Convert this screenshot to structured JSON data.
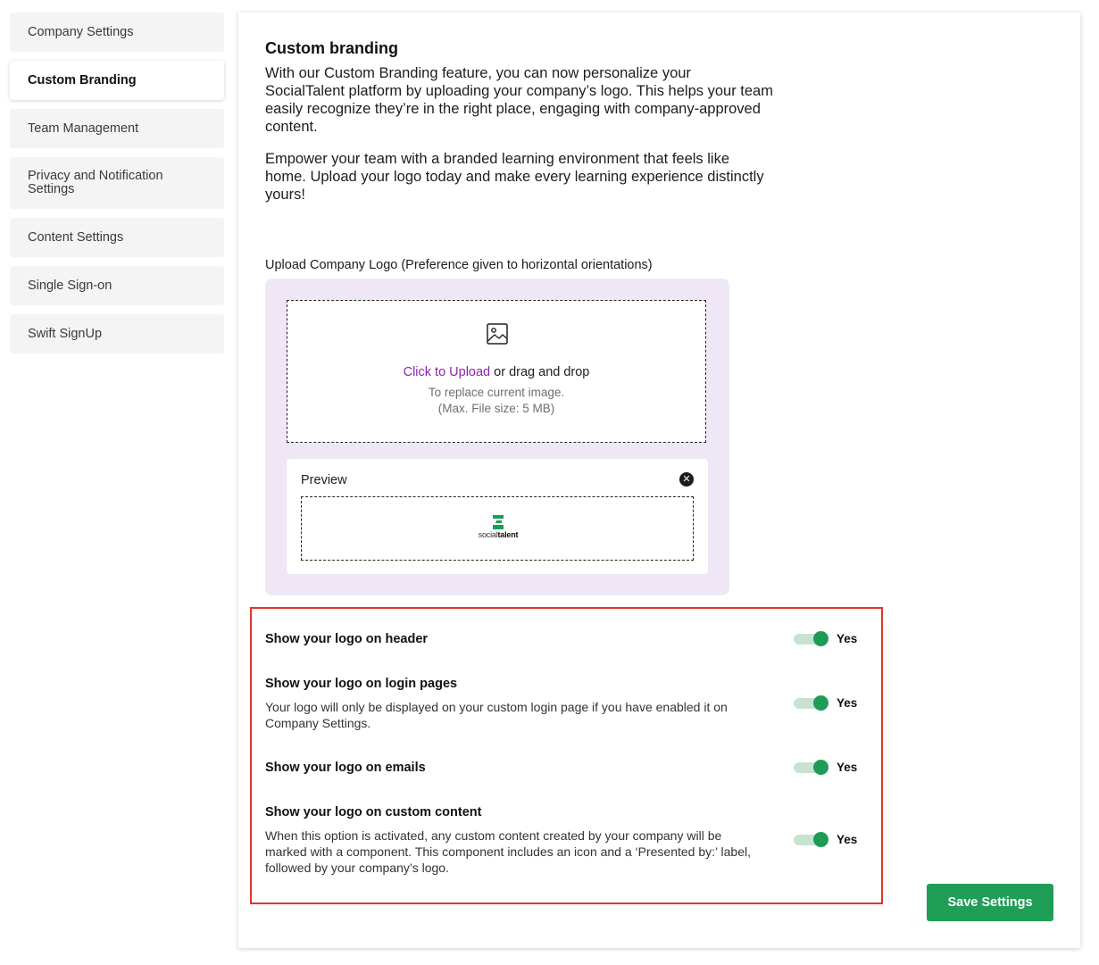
{
  "sidebar": {
    "items": [
      {
        "label": "Company Settings"
      },
      {
        "label": "Custom Branding"
      },
      {
        "label": "Team Management"
      },
      {
        "label": "Privacy and Notification Settings"
      },
      {
        "label": "Content Settings"
      },
      {
        "label": "Single Sign-on"
      },
      {
        "label": "Swift SignUp"
      }
    ],
    "active": "Custom Branding"
  },
  "main": {
    "title": "Custom branding",
    "paragraph1": "With our Custom Branding feature, you can now personalize your SocialTalent platform by uploading your company’s logo. This helps your team easily recognize they’re in the right place, engaging with company-approved content.",
    "paragraph2": "Empower your team with a branded learning environment that feels like home. Upload your logo today and make every learning experience distinctly yours!",
    "upload": {
      "label": "Upload Company Logo (Preference given to horizontal orientations)",
      "click_text": "Click to Upload",
      "drag_text": "or drag and drop",
      "sub1": "To replace current image.",
      "sub2": "(Max. File size: 5 MB)",
      "preview_label": "Preview",
      "preview_logo_text_light": "social",
      "preview_logo_text_bold": "talent"
    },
    "settings": [
      {
        "title": "Show your logo on header",
        "description": "",
        "toggle": "Yes"
      },
      {
        "title": "Show your logo on login pages",
        "description": "Your logo will only be displayed on your custom login page if you have enabled it on Company Settings.",
        "toggle": "Yes"
      },
      {
        "title": "Show your logo on emails",
        "description": "",
        "toggle": "Yes"
      },
      {
        "title": "Show your logo on custom content",
        "description": "When this option is activated, any custom content created by your company will be marked with a component. This component includes an icon and a ‘Presented by:’ label, followed by your company’s logo.",
        "toggle": "Yes"
      }
    ],
    "save_label": "Save Settings"
  },
  "colors": {
    "accent_green": "#1f9e56",
    "link_purple": "#8e24aa",
    "upload_bg": "#efe7f5",
    "highlight_red": "#e0352b"
  }
}
